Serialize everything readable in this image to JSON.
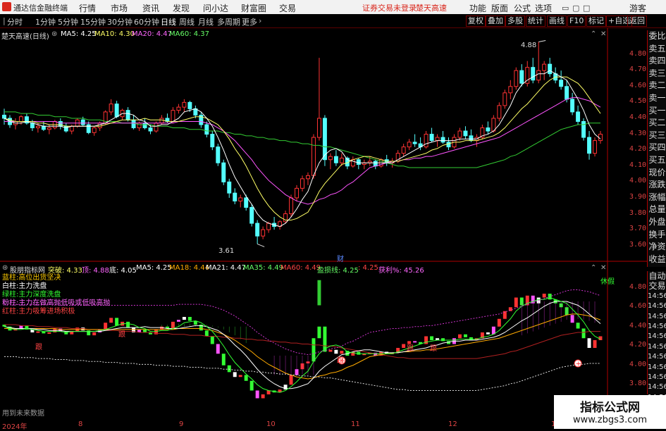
{
  "app": {
    "title": "通达信金融终端",
    "menu": [
      "行情",
      "市场",
      "资讯",
      "发现",
      "问小达",
      "财富圈",
      "交易"
    ],
    "alert": "证券交易未登录",
    "stock_name_title": "楚天高速",
    "right_menu": [
      "功能",
      "版面",
      "公式",
      "选项"
    ],
    "guest": "游客"
  },
  "toolbar": {
    "periods": [
      "分时",
      "1分钟",
      "5分钟",
      "15分钟",
      "30分钟",
      "60分钟",
      "日线",
      "周线",
      "月线",
      "多周期",
      "更多"
    ],
    "active": "日线",
    "right_buttons": [
      "复权",
      "叠加",
      "多股",
      "统计",
      "画线",
      "F10",
      "标记",
      "+自选",
      "返回"
    ]
  },
  "main_chart": {
    "header": "楚天高速(日线)",
    "ma_labels": [
      {
        "text": "MA5: 4.25",
        "color": "#ffffff"
      },
      {
        "text": "MA10: 4.30",
        "color": "#ffff66"
      },
      {
        "text": "MA20: 4.47",
        "color": "#ff66ff"
      },
      {
        "text": "MA60: 4.37",
        "color": "#66ff66"
      }
    ],
    "high_label": "4.88",
    "low_label": "3.61",
    "marker": "财",
    "y_ticks": [
      "4.80",
      "4.70",
      "4.60",
      "4.50",
      "4.40",
      "4.30",
      "4.20",
      "4.10",
      "4.00",
      "3.90",
      "3.80",
      "3.70",
      "3.60"
    ]
  },
  "indicator": {
    "name": "股朋指标网",
    "values": [
      {
        "text": "突破: 4.33",
        "color": "#ffff66"
      },
      {
        "text": "顶: 4.88",
        "color": "#ff66ff"
      },
      {
        "text": "底: 4.05",
        "color": "#ffffff"
      },
      {
        "text": "MA5: 4.25",
        "color": "#ffffff"
      },
      {
        "text": "MA18: 4.44",
        "color": "#ffaa00"
      },
      {
        "text": "MA21: 4.47",
        "color": "#ffffff"
      },
      {
        "text": "MA35: 4.49",
        "color": "#66ff66"
      },
      {
        "text": "MA60: 4.49",
        "color": "#ff4444"
      },
      {
        "text": "盈损线: 4.25",
        "color": "#66ff66"
      },
      {
        "text": ": 4.25",
        "color": "#ff4444"
      },
      {
        "text": "获利%: 45.26",
        "color": "#ff66ff"
      }
    ],
    "legend": [
      {
        "text": "蓝柱:高位出货坚决",
        "color": "#ffcc00"
      },
      {
        "text": "白柱:主力洗盘",
        "color": "#ffffff"
      },
      {
        "text": "绿柱:主力深度洗盘",
        "color": "#33ff33"
      },
      {
        "text": "粉柱:主力在做高抛低吸或低吸高抛",
        "color": "#ff66ff"
      },
      {
        "text": "红柱:主力吸筹进场积极",
        "color": "#ff4444"
      }
    ],
    "rest_label": "休假",
    "buy_label": "跟",
    "footer": "用到未来数据",
    "y_ticks": [
      "4.80",
      "4.60",
      "4.40",
      "4.20",
      "4.00",
      "3.80"
    ]
  },
  "right_panel": {
    "upper": [
      "委比",
      "卖五",
      "卖四",
      "卖三",
      "卖二",
      "卖一",
      "买一",
      "买二",
      "买三",
      "买四",
      "买五",
      "现价",
      "涨跌",
      "涨幅",
      "总量",
      "外盘",
      "换手",
      "净资",
      "收益"
    ],
    "lower": [
      "自动",
      "交易",
      "14:56",
      "14:56",
      "14:56",
      "14:56",
      "14:56",
      "14:56",
      "14:56",
      "14:56",
      "14:56",
      "14:56",
      "14:56"
    ]
  },
  "x_axis": [
    "2024年",
    "8",
    "9",
    "10",
    "11",
    "12",
    "1"
  ],
  "watermark": {
    "line1": "指标公式网",
    "line2": "www.zbgs3.com"
  },
  "colors": {
    "up": "#ff3333",
    "down": "#54ffff",
    "axis": "#b00000",
    "ma5": "#ffffff",
    "ma10": "#ffff66",
    "ma20": "#ff55ff",
    "ma60": "#33cc33"
  },
  "chart_data": {
    "type": "candlestick",
    "ylim": [
      3.55,
      4.9
    ],
    "candles": [
      [
        4.42,
        4.46,
        4.36,
        4.4
      ],
      [
        4.4,
        4.42,
        4.34,
        4.36
      ],
      [
        4.36,
        4.4,
        4.33,
        4.38
      ],
      [
        4.38,
        4.42,
        4.36,
        4.41
      ],
      [
        4.41,
        4.43,
        4.36,
        4.37
      ],
      [
        4.37,
        4.39,
        4.32,
        4.34
      ],
      [
        4.34,
        4.37,
        4.31,
        4.35
      ],
      [
        4.35,
        4.38,
        4.32,
        4.33
      ],
      [
        4.33,
        4.36,
        4.3,
        4.34
      ],
      [
        4.34,
        4.39,
        4.33,
        4.38
      ],
      [
        4.38,
        4.4,
        4.33,
        4.35
      ],
      [
        4.35,
        4.37,
        4.31,
        4.32
      ],
      [
        4.32,
        4.36,
        4.3,
        4.35
      ],
      [
        4.35,
        4.4,
        4.34,
        4.39
      ],
      [
        4.39,
        4.41,
        4.35,
        4.36
      ],
      [
        4.36,
        4.38,
        4.3,
        4.31
      ],
      [
        4.31,
        4.35,
        4.29,
        4.34
      ],
      [
        4.34,
        4.38,
        4.32,
        4.37
      ],
      [
        4.37,
        4.45,
        4.36,
        4.44
      ],
      [
        4.44,
        4.52,
        4.42,
        4.49
      ],
      [
        4.49,
        4.51,
        4.4,
        4.41
      ],
      [
        4.41,
        4.46,
        4.39,
        4.45
      ],
      [
        4.45,
        4.47,
        4.38,
        4.39
      ],
      [
        4.39,
        4.42,
        4.33,
        4.34
      ],
      [
        4.34,
        4.38,
        4.32,
        4.37
      ],
      [
        4.37,
        4.4,
        4.33,
        4.34
      ],
      [
        4.34,
        4.36,
        4.3,
        4.32
      ],
      [
        4.32,
        4.38,
        4.31,
        4.37
      ],
      [
        4.37,
        4.42,
        4.36,
        4.4
      ],
      [
        4.4,
        4.43,
        4.37,
        4.38
      ],
      [
        4.38,
        4.47,
        4.37,
        4.45
      ],
      [
        4.45,
        4.49,
        4.43,
        4.47
      ],
      [
        4.47,
        4.52,
        4.44,
        4.5
      ],
      [
        4.5,
        4.51,
        4.44,
        4.46
      ],
      [
        4.46,
        4.48,
        4.4,
        4.42
      ],
      [
        4.42,
        4.44,
        4.34,
        4.36
      ],
      [
        4.36,
        4.38,
        4.28,
        4.3
      ],
      [
        4.3,
        4.32,
        4.2,
        4.22
      ],
      [
        4.22,
        4.24,
        4.1,
        4.12
      ],
      [
        4.12,
        4.14,
        3.98,
        4.0
      ],
      [
        4.0,
        4.02,
        3.9,
        3.93
      ],
      [
        3.93,
        3.96,
        3.86,
        3.88
      ],
      [
        3.88,
        3.92,
        3.84,
        3.9
      ],
      [
        3.9,
        3.92,
        3.82,
        3.84
      ],
      [
        3.84,
        3.86,
        3.72,
        3.74
      ],
      [
        3.74,
        3.76,
        3.61,
        3.66
      ],
      [
        3.66,
        3.72,
        3.64,
        3.7
      ],
      [
        3.7,
        3.75,
        3.68,
        3.74
      ],
      [
        3.74,
        3.78,
        3.7,
        3.72
      ],
      [
        3.72,
        3.76,
        3.7,
        3.75
      ],
      [
        3.75,
        3.82,
        3.74,
        3.8
      ],
      [
        3.8,
        3.92,
        3.78,
        3.9
      ],
      [
        3.9,
        3.98,
        3.88,
        3.96
      ],
      [
        3.96,
        4.04,
        3.94,
        4.02
      ],
      [
        4.02,
        4.06,
        3.98,
        4.04
      ],
      [
        4.04,
        4.3,
        4.02,
        4.28
      ],
      [
        4.28,
        4.78,
        4.26,
        4.4
      ],
      [
        4.4,
        4.42,
        4.1,
        4.14
      ],
      [
        4.14,
        4.18,
        4.08,
        4.16
      ],
      [
        4.16,
        4.2,
        4.1,
        4.12
      ],
      [
        4.12,
        4.18,
        4.1,
        4.15
      ],
      [
        4.15,
        4.16,
        4.08,
        4.1
      ],
      [
        4.1,
        4.16,
        4.09,
        4.14
      ],
      [
        4.14,
        4.15,
        4.08,
        4.11
      ],
      [
        4.11,
        4.14,
        4.08,
        4.12
      ],
      [
        4.12,
        4.16,
        4.1,
        4.13
      ],
      [
        4.13,
        4.14,
        4.08,
        4.1
      ],
      [
        4.1,
        4.15,
        4.09,
        4.14
      ],
      [
        4.14,
        4.17,
        4.1,
        4.12
      ],
      [
        4.12,
        4.15,
        4.09,
        4.13
      ],
      [
        4.13,
        4.2,
        4.12,
        4.18
      ],
      [
        4.18,
        4.24,
        4.16,
        4.22
      ],
      [
        4.22,
        4.27,
        4.2,
        4.25
      ],
      [
        4.25,
        4.3,
        4.22,
        4.24
      ],
      [
        4.24,
        4.28,
        4.2,
        4.22
      ],
      [
        4.22,
        4.32,
        4.21,
        4.3
      ],
      [
        4.3,
        4.34,
        4.25,
        4.26
      ],
      [
        4.26,
        4.3,
        4.22,
        4.28
      ],
      [
        4.28,
        4.32,
        4.24,
        4.25
      ],
      [
        4.25,
        4.28,
        4.2,
        4.22
      ],
      [
        4.22,
        4.3,
        4.21,
        4.28
      ],
      [
        4.28,
        4.34,
        4.26,
        4.32
      ],
      [
        4.32,
        4.35,
        4.27,
        4.29
      ],
      [
        4.29,
        4.33,
        4.25,
        4.26
      ],
      [
        4.26,
        4.3,
        4.22,
        4.28
      ],
      [
        4.28,
        4.36,
        4.27,
        4.34
      ],
      [
        4.34,
        4.38,
        4.3,
        4.32
      ],
      [
        4.32,
        4.42,
        4.31,
        4.4
      ],
      [
        4.4,
        4.5,
        4.38,
        4.48
      ],
      [
        4.48,
        4.58,
        4.46,
        4.56
      ],
      [
        4.56,
        4.64,
        4.52,
        4.6
      ],
      [
        4.6,
        4.72,
        4.58,
        4.7
      ],
      [
        4.7,
        4.74,
        4.6,
        4.62
      ],
      [
        4.62,
        4.76,
        4.6,
        4.72
      ],
      [
        4.72,
        4.78,
        4.62,
        4.64
      ],
      [
        4.64,
        4.88,
        4.62,
        4.7
      ],
      [
        4.7,
        4.76,
        4.64,
        4.74
      ],
      [
        4.74,
        4.78,
        4.66,
        4.68
      ],
      [
        4.68,
        4.72,
        4.62,
        4.64
      ],
      [
        4.64,
        4.7,
        4.58,
        4.6
      ],
      [
        4.6,
        4.64,
        4.5,
        4.52
      ],
      [
        4.52,
        4.56,
        4.42,
        4.44
      ],
      [
        4.44,
        4.48,
        4.36,
        4.38
      ],
      [
        4.38,
        4.4,
        4.26,
        4.28
      ],
      [
        4.28,
        4.32,
        4.14,
        4.18
      ],
      [
        4.18,
        4.28,
        4.16,
        4.26
      ],
      [
        4.26,
        4.32,
        4.24,
        4.3
      ]
    ],
    "ma5": [
      4.4,
      4.38,
      4.37,
      4.37,
      4.38,
      4.37,
      4.36,
      4.35,
      4.35,
      4.35,
      4.35,
      4.34,
      4.35,
      4.35,
      4.35,
      4.35,
      4.35,
      4.36,
      4.37,
      4.39,
      4.41,
      4.43,
      4.43,
      4.42,
      4.39,
      4.38,
      4.35,
      4.35,
      4.36,
      4.36,
      4.38,
      4.4,
      4.44,
      4.45,
      4.46,
      4.44,
      4.4,
      4.35,
      4.28,
      4.2,
      4.11,
      4.03,
      3.97,
      3.91,
      3.86,
      3.8,
      3.76,
      3.74,
      3.73,
      3.72,
      3.74,
      3.78,
      3.83,
      3.89,
      3.94,
      4.04,
      4.12,
      4.17,
      4.2,
      4.21,
      4.19,
      4.14,
      4.13,
      4.12,
      4.12,
      4.12,
      4.12,
      4.12,
      4.12,
      4.12,
      4.14,
      4.16,
      4.18,
      4.2,
      4.22,
      4.24,
      4.25,
      4.26,
      4.26,
      4.26,
      4.26,
      4.27,
      4.27,
      4.27,
      4.27,
      4.29,
      4.3,
      4.32,
      4.36,
      4.42,
      4.48,
      4.56,
      4.61,
      4.64,
      4.66,
      4.68,
      4.68,
      4.7,
      4.68,
      4.66,
      4.64,
      4.58,
      4.52,
      4.45,
      4.36,
      4.3,
      4.27
    ],
    "ma10": [
      4.4,
      4.39,
      4.38,
      4.38,
      4.38,
      4.38,
      4.37,
      4.37,
      4.36,
      4.36,
      4.36,
      4.35,
      4.35,
      4.35,
      4.35,
      4.35,
      4.35,
      4.35,
      4.36,
      4.37,
      4.38,
      4.39,
      4.39,
      4.39,
      4.39,
      4.4,
      4.39,
      4.39,
      4.39,
      4.38,
      4.38,
      4.38,
      4.39,
      4.4,
      4.41,
      4.41,
      4.4,
      4.38,
      4.36,
      4.32,
      4.27,
      4.21,
      4.16,
      4.1,
      4.03,
      3.96,
      3.9,
      3.85,
      3.81,
      3.78,
      3.76,
      3.76,
      3.77,
      3.79,
      3.81,
      3.87,
      3.94,
      3.99,
      4.03,
      4.07,
      4.11,
      4.12,
      4.14,
      4.15,
      4.16,
      4.16,
      4.15,
      4.14,
      4.13,
      4.13,
      4.13,
      4.14,
      4.15,
      4.16,
      4.17,
      4.18,
      4.2,
      4.21,
      4.23,
      4.24,
      4.25,
      4.25,
      4.26,
      4.26,
      4.26,
      4.27,
      4.28,
      4.29,
      4.31,
      4.34,
      4.38,
      4.42,
      4.46,
      4.49,
      4.53,
      4.57,
      4.61,
      4.64,
      4.66,
      4.66,
      4.66,
      4.64,
      4.62,
      4.58,
      4.53,
      4.48,
      4.43
    ],
    "ma20": [
      4.38,
      4.38,
      4.38,
      4.38,
      4.38,
      4.38,
      4.38,
      4.38,
      4.38,
      4.38,
      4.37,
      4.37,
      4.37,
      4.37,
      4.37,
      4.37,
      4.37,
      4.37,
      4.37,
      4.37,
      4.37,
      4.37,
      4.37,
      4.37,
      4.37,
      4.37,
      4.37,
      4.37,
      4.37,
      4.37,
      4.37,
      4.38,
      4.38,
      4.38,
      4.38,
      4.38,
      4.37,
      4.36,
      4.34,
      4.32,
      4.29,
      4.26,
      4.22,
      4.18,
      4.14,
      4.09,
      4.05,
      4.01,
      3.98,
      3.95,
      3.92,
      3.9,
      3.88,
      3.87,
      3.86,
      3.87,
      3.89,
      3.9,
      3.92,
      3.93,
      3.95,
      3.98,
      4.0,
      4.03,
      4.06,
      4.09,
      4.1,
      4.11,
      4.12,
      4.13,
      4.13,
      4.14,
      4.14,
      4.15,
      4.15,
      4.16,
      4.16,
      4.17,
      4.18,
      4.19,
      4.2,
      4.21,
      4.22,
      4.23,
      4.24,
      4.25,
      4.26,
      4.27,
      4.28,
      4.3,
      4.32,
      4.34,
      4.36,
      4.38,
      4.4,
      4.42,
      4.44,
      4.46,
      4.48,
      4.5,
      4.52,
      4.53,
      4.53,
      4.52,
      4.51,
      4.49,
      4.47
    ],
    "ma60": [
      4.44,
      4.44,
      4.44,
      4.43,
      4.43,
      4.43,
      4.42,
      4.42,
      4.42,
      4.41,
      4.41,
      4.41,
      4.4,
      4.4,
      4.4,
      4.39,
      4.39,
      4.39,
      4.38,
      4.38,
      4.38,
      4.37,
      4.37,
      4.37,
      4.36,
      4.36,
      4.36,
      4.35,
      4.35,
      4.35,
      4.34,
      4.34,
      4.34,
      4.33,
      4.33,
      4.33,
      4.32,
      4.32,
      4.32,
      4.31,
      4.31,
      4.3,
      4.3,
      4.29,
      4.29,
      4.28,
      4.28,
      4.27,
      4.27,
      4.26,
      4.26,
      4.25,
      4.25,
      4.24,
      4.24,
      4.23,
      4.23,
      4.22,
      4.22,
      4.21,
      4.2,
      4.19,
      4.18,
      4.17,
      4.16,
      4.15,
      4.14,
      4.13,
      4.12,
      4.11,
      4.1,
      4.1,
      4.09,
      4.09,
      4.09,
      4.09,
      4.09,
      4.09,
      4.09,
      4.09,
      4.09,
      4.09,
      4.09,
      4.09,
      4.09,
      4.1,
      4.11,
      4.12,
      4.13,
      4.14,
      4.16,
      4.17,
      4.19,
      4.21,
      4.23,
      4.25,
      4.27,
      4.29,
      4.31,
      4.33,
      4.34,
      4.35,
      4.36,
      4.36,
      4.37,
      4.37,
      4.37
    ]
  }
}
